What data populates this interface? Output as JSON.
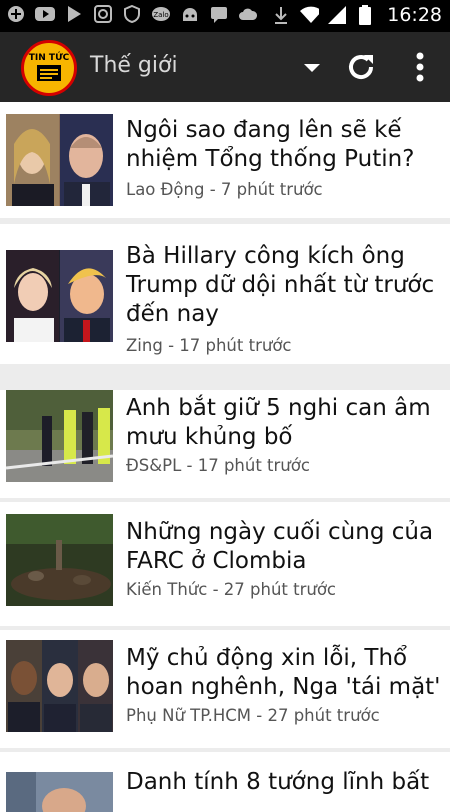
{
  "status_bar": {
    "time": "16:28",
    "left_icons": [
      "add-icon",
      "youtube-icon",
      "play-store-icon",
      "instagram-icon",
      "shield-icon",
      "zalo-icon",
      "android-icon",
      "message-icon",
      "cloud-icon"
    ],
    "right_icons": [
      "download-icon",
      "wifi-icon",
      "signal-icon",
      "battery-icon"
    ]
  },
  "toolbar": {
    "logo_text": "TIN TỨC",
    "section": "Thế giới",
    "accent": "#f7b500"
  },
  "articles": [
    {
      "title": "Ngôi sao đang lên sẽ kế nhiệm Tổng thống Putin?",
      "source": "Lao Động",
      "time": "7 phút trước",
      "meta": "Lao Động - 7 phút trước"
    },
    {
      "title": "Bà Hillary công kích ông Trump dữ dội nhất từ trước đến nay",
      "source": "Zing",
      "time": "17 phút trước",
      "meta": "Zing - 17 phút trước"
    },
    {
      "title": "Anh bắt giữ 5 nghi can âm mưu khủng bố",
      "source": "ĐS&PL",
      "time": "17 phút trước",
      "meta": "ĐS&PL - 17 phút trước"
    },
    {
      "title": "Những ngày cuối cùng của FARC ở Clombia",
      "source": "Kiến Thức",
      "time": "27 phút trước",
      "meta": "Kiến Thức - 27 phút trước"
    },
    {
      "title": "Mỹ chủ động xin lỗi, Thổ hoan nghênh, Nga 'tái mặt'",
      "source": "Phụ Nữ TP.HCM",
      "time": "27 phút trước",
      "meta": "Phụ Nữ TP.HCM - 27 phút trước"
    },
    {
      "title": "Danh tính 8 tướng lĩnh bất",
      "source": "",
      "time": "",
      "meta": ""
    }
  ]
}
